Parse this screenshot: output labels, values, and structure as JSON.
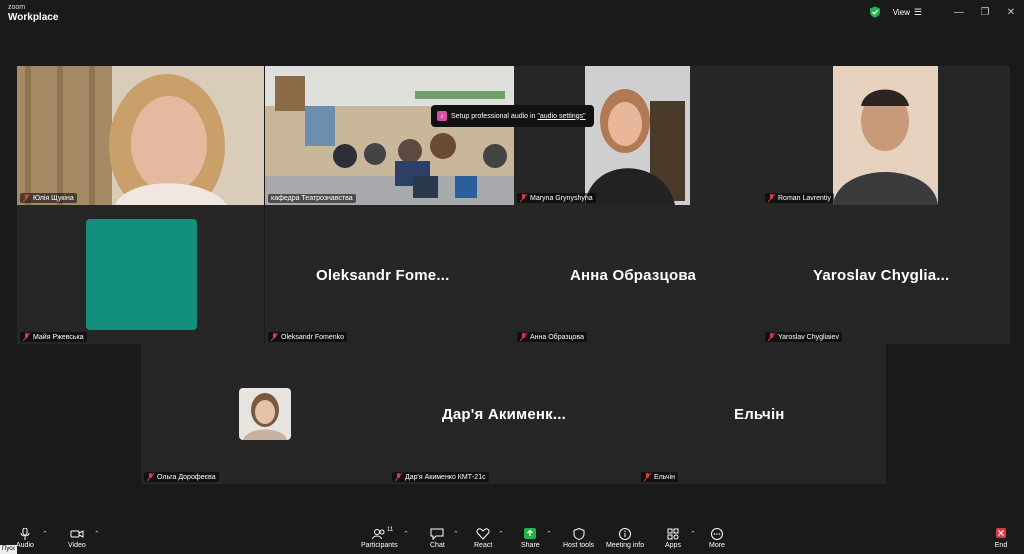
{
  "app": {
    "logo_line1": "zoom",
    "logo_line2": "Workplace",
    "view_label": "View"
  },
  "tooltip": {
    "text": "Setup professional audio in ",
    "link": "\"audio settings\""
  },
  "participants": [
    {
      "name": "Юлія Щукіна"
    },
    {
      "name": "кафедра Театрознавства"
    },
    {
      "name": "Maryna Grynyshyna"
    },
    {
      "name": "Roman Lavrentiy"
    },
    {
      "name": "Майя Ржевська"
    },
    {
      "name": "Oleksandr Fomenko",
      "display": "Oleksandr  Fome..."
    },
    {
      "name": "Анна Образцова",
      "display": "Анна Образцова"
    },
    {
      "name": "Yaroslav Chygliaiev",
      "display": "Yaroslav  Chyglia..."
    },
    {
      "name": "Ольга Дорофеєва"
    },
    {
      "name": "Дар'я Акименко КМТ-21с",
      "display": "Дар'я  Акименк..."
    },
    {
      "name": "Ельчін",
      "display": "Ельчін"
    }
  ],
  "toolbar": {
    "audio": "Audio",
    "video": "Video",
    "participants": "Participants",
    "participants_count": "11",
    "chat": "Chat",
    "react": "React",
    "share": "Share",
    "host_tools": "Host tools",
    "meeting_info": "Meeting info",
    "apps": "Apps",
    "more": "More",
    "end": "End"
  },
  "taskbar": {
    "start": "Пуск"
  },
  "colors": {
    "active_border": "#3ec86a",
    "muted_red": "#e0384a",
    "share_green": "#24b14c",
    "avatar_teal": "#13907c"
  }
}
